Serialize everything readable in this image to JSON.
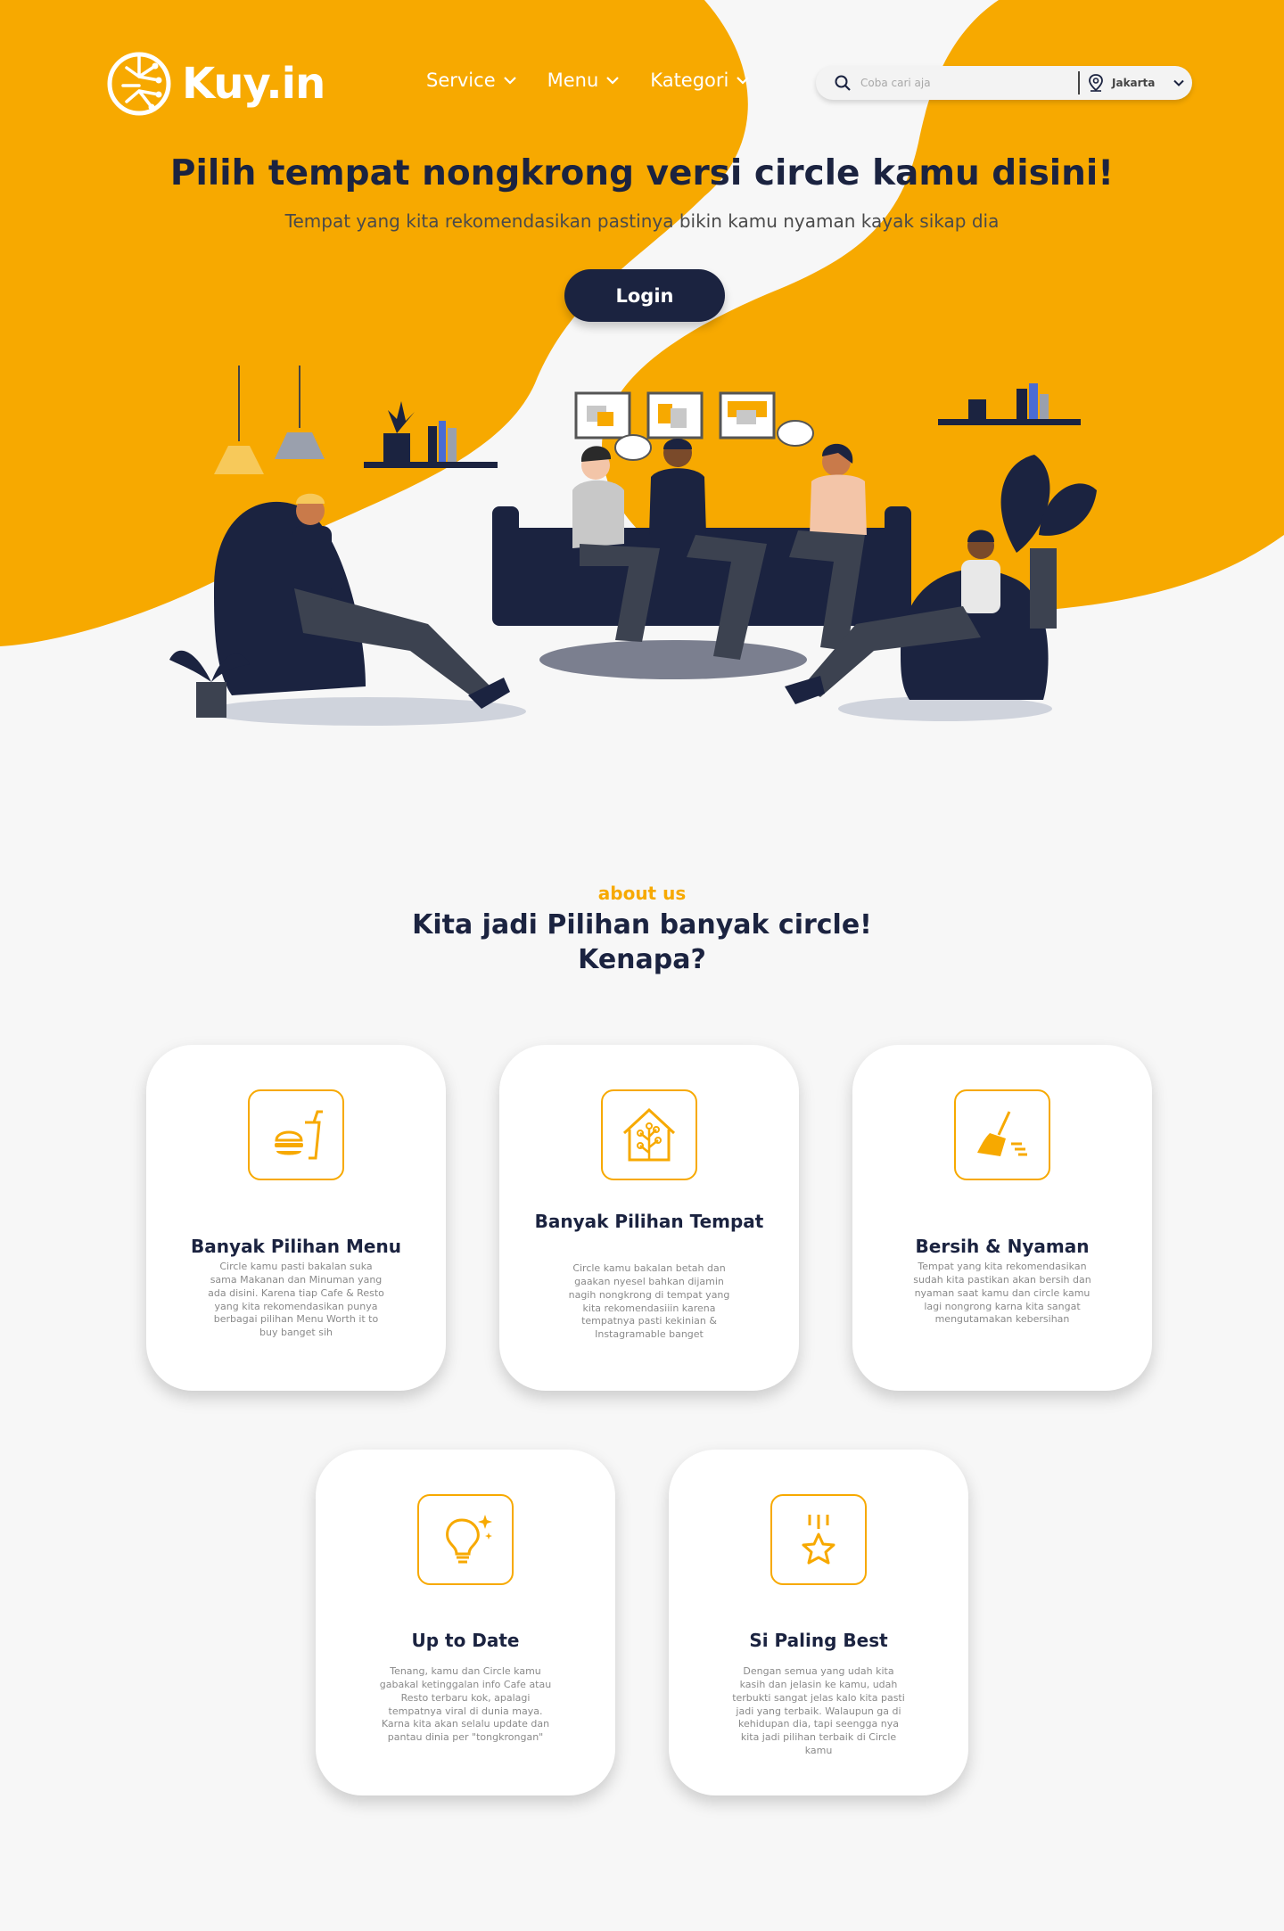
{
  "brand": {
    "name": "Kuy.in"
  },
  "nav": [
    {
      "label": "Service"
    },
    {
      "label": "Menu"
    },
    {
      "label": "Kategori"
    }
  ],
  "search": {
    "placeholder": "Coba cari aja",
    "location": "Jakarta"
  },
  "hero": {
    "title": "Pilih tempat nongkrong versi circle kamu disini!",
    "subtitle": "Tempat yang kita rekomendasikan pastinya bikin kamu nyaman kayak sikap dia",
    "login_label": "Login"
  },
  "about": {
    "label": "about us",
    "title_line1": "Kita jadi Pilihan banyak circle!",
    "title_line2": "Kenapa?"
  },
  "features": [
    {
      "icon": "food-drink-icon",
      "title": "Banyak Pilihan Menu",
      "desc": "Circle kamu pasti bakalan suka sama Makanan dan Minuman yang ada disini. Karena tiap Cafe & Resto yang kita rekomendasikan punya berbagai pilihan Menu Worth it to buy banget sih"
    },
    {
      "icon": "house-tree-icon",
      "title": "Banyak Pilihan Tempat",
      "desc": "Circle kamu bakalan betah dan gaakan nyesel bahkan dijamin nagih nongkrong di tempat yang kita rekomendasiiin karena tempatnya pasti kekinian & Instagramable banget"
    },
    {
      "icon": "broom-icon",
      "title": "Bersih & Nyaman",
      "desc": "Tempat yang kita rekomendasikan sudah kita pastikan akan bersih dan nyaman saat kamu dan circle kamu lagi nongrong karna kita sangat mengutamakan kebersihan"
    },
    {
      "icon": "lightbulb-icon",
      "title": "Up to Date",
      "desc": "Tenang, kamu dan Circle kamu gabakal ketinggalan info Cafe atau Resto terbaru kok, apalagi tempatnya viral di dunia maya. Karna kita akan selalu update dan pantau dinia per \"tongkrongan\""
    },
    {
      "icon": "star-icon",
      "title": "Si Paling Best",
      "desc": "Dengan semua yang udah kita kasih dan jelasin ke kamu, udah terbukti sangat jelas kalo kita pasti jadi yang terbaik. Walaupun ga di kehidupan dia, tapi seengga nya kita jadi pilihan terbaik di Circle kamu"
    }
  ],
  "colors": {
    "accent": "#F7A900",
    "navy": "#1B2340",
    "background": "#F7F7F7"
  }
}
